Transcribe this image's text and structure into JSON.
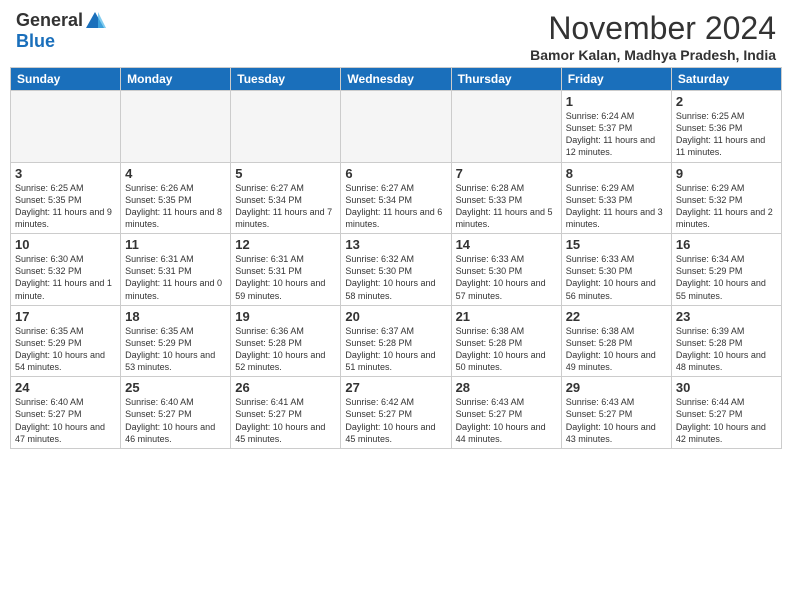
{
  "header": {
    "logo_general": "General",
    "logo_blue": "Blue",
    "month_title": "November 2024",
    "location": "Bamor Kalan, Madhya Pradesh, India"
  },
  "days_of_week": [
    "Sunday",
    "Monday",
    "Tuesday",
    "Wednesday",
    "Thursday",
    "Friday",
    "Saturday"
  ],
  "weeks": [
    [
      {
        "day": "",
        "info": "",
        "empty": true
      },
      {
        "day": "",
        "info": "",
        "empty": true
      },
      {
        "day": "",
        "info": "",
        "empty": true
      },
      {
        "day": "",
        "info": "",
        "empty": true
      },
      {
        "day": "",
        "info": "",
        "empty": true
      },
      {
        "day": "1",
        "info": "Sunrise: 6:24 AM\nSunset: 5:37 PM\nDaylight: 11 hours and 12 minutes."
      },
      {
        "day": "2",
        "info": "Sunrise: 6:25 AM\nSunset: 5:36 PM\nDaylight: 11 hours and 11 minutes."
      }
    ],
    [
      {
        "day": "3",
        "info": "Sunrise: 6:25 AM\nSunset: 5:35 PM\nDaylight: 11 hours and 9 minutes."
      },
      {
        "day": "4",
        "info": "Sunrise: 6:26 AM\nSunset: 5:35 PM\nDaylight: 11 hours and 8 minutes."
      },
      {
        "day": "5",
        "info": "Sunrise: 6:27 AM\nSunset: 5:34 PM\nDaylight: 11 hours and 7 minutes."
      },
      {
        "day": "6",
        "info": "Sunrise: 6:27 AM\nSunset: 5:34 PM\nDaylight: 11 hours and 6 minutes."
      },
      {
        "day": "7",
        "info": "Sunrise: 6:28 AM\nSunset: 5:33 PM\nDaylight: 11 hours and 5 minutes."
      },
      {
        "day": "8",
        "info": "Sunrise: 6:29 AM\nSunset: 5:33 PM\nDaylight: 11 hours and 3 minutes."
      },
      {
        "day": "9",
        "info": "Sunrise: 6:29 AM\nSunset: 5:32 PM\nDaylight: 11 hours and 2 minutes."
      }
    ],
    [
      {
        "day": "10",
        "info": "Sunrise: 6:30 AM\nSunset: 5:32 PM\nDaylight: 11 hours and 1 minute."
      },
      {
        "day": "11",
        "info": "Sunrise: 6:31 AM\nSunset: 5:31 PM\nDaylight: 11 hours and 0 minutes."
      },
      {
        "day": "12",
        "info": "Sunrise: 6:31 AM\nSunset: 5:31 PM\nDaylight: 10 hours and 59 minutes."
      },
      {
        "day": "13",
        "info": "Sunrise: 6:32 AM\nSunset: 5:30 PM\nDaylight: 10 hours and 58 minutes."
      },
      {
        "day": "14",
        "info": "Sunrise: 6:33 AM\nSunset: 5:30 PM\nDaylight: 10 hours and 57 minutes."
      },
      {
        "day": "15",
        "info": "Sunrise: 6:33 AM\nSunset: 5:30 PM\nDaylight: 10 hours and 56 minutes."
      },
      {
        "day": "16",
        "info": "Sunrise: 6:34 AM\nSunset: 5:29 PM\nDaylight: 10 hours and 55 minutes."
      }
    ],
    [
      {
        "day": "17",
        "info": "Sunrise: 6:35 AM\nSunset: 5:29 PM\nDaylight: 10 hours and 54 minutes."
      },
      {
        "day": "18",
        "info": "Sunrise: 6:35 AM\nSunset: 5:29 PM\nDaylight: 10 hours and 53 minutes."
      },
      {
        "day": "19",
        "info": "Sunrise: 6:36 AM\nSunset: 5:28 PM\nDaylight: 10 hours and 52 minutes."
      },
      {
        "day": "20",
        "info": "Sunrise: 6:37 AM\nSunset: 5:28 PM\nDaylight: 10 hours and 51 minutes."
      },
      {
        "day": "21",
        "info": "Sunrise: 6:38 AM\nSunset: 5:28 PM\nDaylight: 10 hours and 50 minutes."
      },
      {
        "day": "22",
        "info": "Sunrise: 6:38 AM\nSunset: 5:28 PM\nDaylight: 10 hours and 49 minutes."
      },
      {
        "day": "23",
        "info": "Sunrise: 6:39 AM\nSunset: 5:28 PM\nDaylight: 10 hours and 48 minutes."
      }
    ],
    [
      {
        "day": "24",
        "info": "Sunrise: 6:40 AM\nSunset: 5:27 PM\nDaylight: 10 hours and 47 minutes."
      },
      {
        "day": "25",
        "info": "Sunrise: 6:40 AM\nSunset: 5:27 PM\nDaylight: 10 hours and 46 minutes."
      },
      {
        "day": "26",
        "info": "Sunrise: 6:41 AM\nSunset: 5:27 PM\nDaylight: 10 hours and 45 minutes."
      },
      {
        "day": "27",
        "info": "Sunrise: 6:42 AM\nSunset: 5:27 PM\nDaylight: 10 hours and 45 minutes."
      },
      {
        "day": "28",
        "info": "Sunrise: 6:43 AM\nSunset: 5:27 PM\nDaylight: 10 hours and 44 minutes."
      },
      {
        "day": "29",
        "info": "Sunrise: 6:43 AM\nSunset: 5:27 PM\nDaylight: 10 hours and 43 minutes."
      },
      {
        "day": "30",
        "info": "Sunrise: 6:44 AM\nSunset: 5:27 PM\nDaylight: 10 hours and 42 minutes."
      }
    ]
  ]
}
